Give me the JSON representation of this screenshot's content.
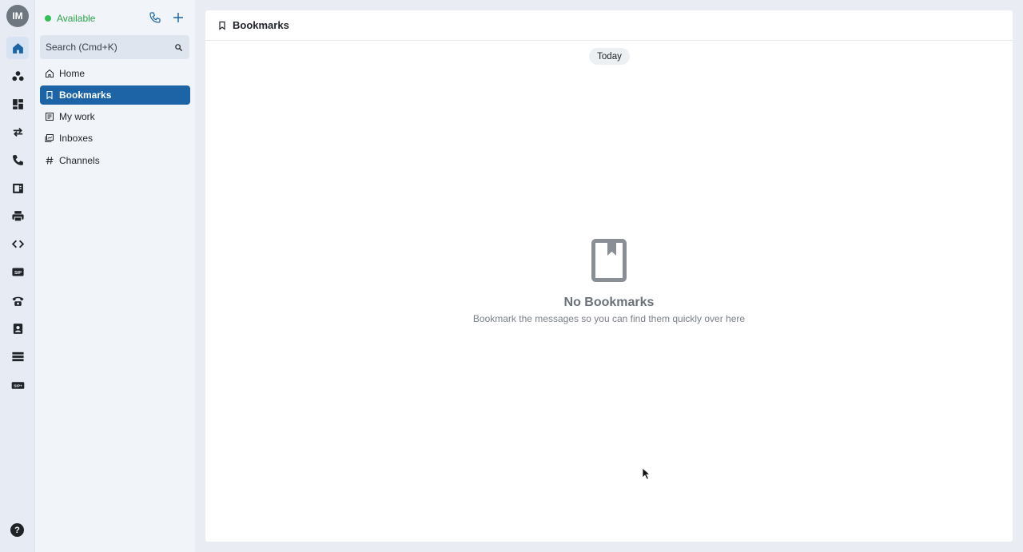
{
  "user": {
    "initials": "IM"
  },
  "status": {
    "label": "Available",
    "color": "#2ec15a"
  },
  "search": {
    "placeholder": "Search (Cmd+K)"
  },
  "rail": {
    "icons": [
      "home-icon",
      "team-icon",
      "dashboard-icon",
      "transfer-icon",
      "call-log-icon",
      "fax-icon",
      "print-icon",
      "code-icon",
      "sip-icon",
      "phone-icon",
      "contacts-icon",
      "servers-icon",
      "sip-trunk-icon"
    ],
    "labels": {
      "sip": "SIP",
      "sip_trunk": "SIP+"
    }
  },
  "sidebar": {
    "items": [
      {
        "label": "Home",
        "icon": "home-icon"
      },
      {
        "label": "Bookmarks",
        "icon": "bookmark-icon",
        "active": true
      },
      {
        "label": "My work",
        "icon": "my-work-icon"
      },
      {
        "label": "Inboxes",
        "icon": "inboxes-icon"
      },
      {
        "label": "Channels",
        "icon": "hash-icon"
      }
    ]
  },
  "main": {
    "title": "Bookmarks",
    "day_label": "Today",
    "empty_title": "No Bookmarks",
    "empty_subtitle": "Bookmark the messages so you can find them quickly over here"
  },
  "colors": {
    "accent": "#1c64a6",
    "rail_bg": "#e7ecf4",
    "sidebar_bg": "#f1f4f9"
  }
}
